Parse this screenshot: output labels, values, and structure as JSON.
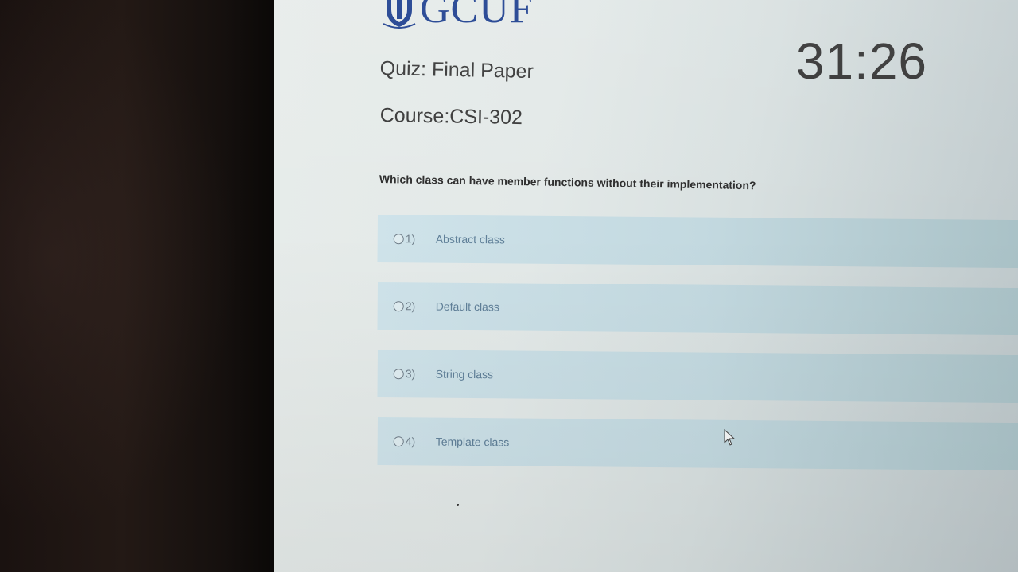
{
  "header": {
    "logo_text": "GCUF",
    "timer": "31:26"
  },
  "quiz": {
    "title": "Quiz: Final Paper",
    "course": "Course:CSI-302"
  },
  "question": {
    "text": "Which class can have member functions without their implementation?",
    "options": [
      {
        "number": "1)",
        "label": "Abstract class"
      },
      {
        "number": "2)",
        "label": "Default class"
      },
      {
        "number": "3)",
        "label": "String class"
      },
      {
        "number": "4)",
        "label": "Template class"
      }
    ]
  },
  "colors": {
    "logo": "#1d3f8f",
    "option_background": "#cfe3ea",
    "option_text": "#5f7f98"
  }
}
